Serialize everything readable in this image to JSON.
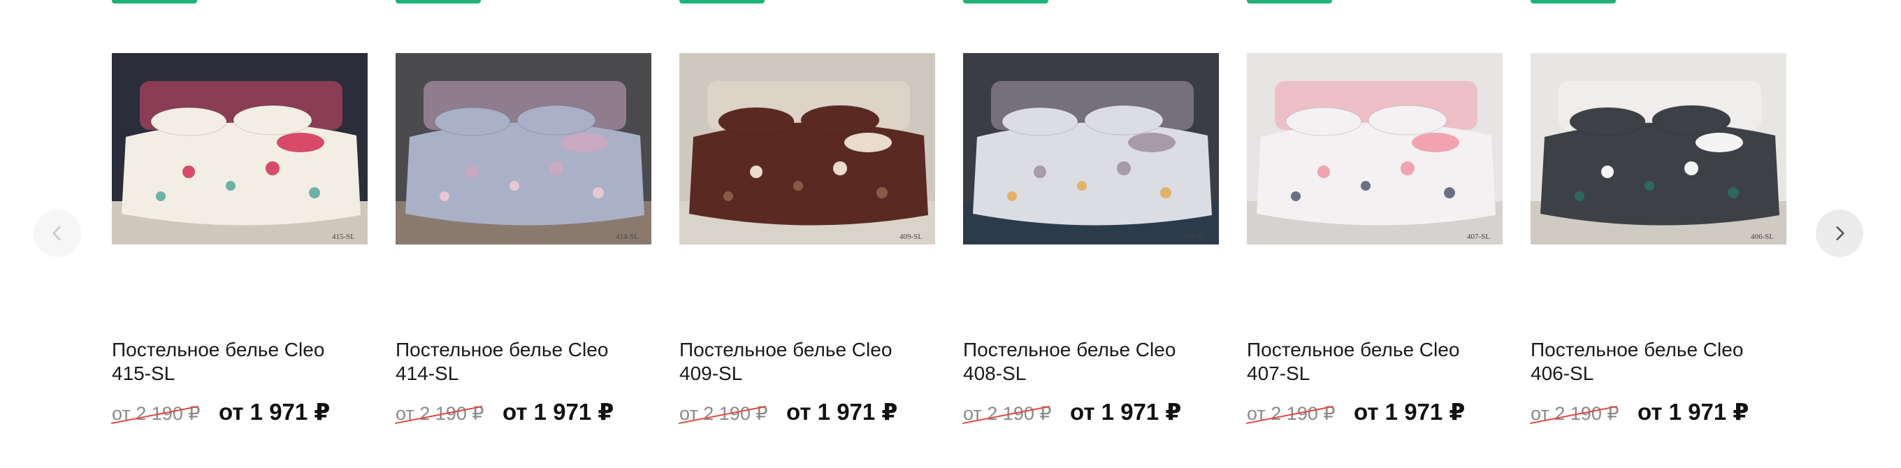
{
  "carousel": {
    "prev_icon": "chevron-left-icon",
    "next_icon": "chevron-right-icon",
    "products": [
      {
        "title": "Постельное белье Cleo 415-SL",
        "old_price": "от 2 190 ₽",
        "price": "от 1 971 ₽",
        "image_caption": "415-SL",
        "palette": {
          "wall": "#2b2d3a",
          "bed": "#f2eee4",
          "accent": "#d94a6a",
          "accent2": "#6fb2a8",
          "floor": "#cfc7bb"
        }
      },
      {
        "title": "Постельное белье Cleo 414-SL",
        "old_price": "от 2 190 ₽",
        "price": "от 1 971 ₽",
        "image_caption": "414-SL",
        "palette": {
          "wall": "#4b4b4e",
          "bed": "#a9b0c8",
          "accent": "#c9a8c2",
          "accent2": "#e8c8d0",
          "floor": "#8a7a6e"
        }
      },
      {
        "title": "Постельное белье Cleo 409-SL",
        "old_price": "от 2 190 ₽",
        "price": "от 1 971 ₽",
        "image_caption": "409-SL",
        "palette": {
          "wall": "#cfc8bf",
          "bed": "#5a2a22",
          "accent": "#e9dccc",
          "accent2": "#8b5a46",
          "floor": "#d9d3ca"
        }
      },
      {
        "title": "Постельное белье Cleo 408-SL",
        "old_price": "от 2 190 ₽",
        "price": "от 1 971 ₽",
        "image_caption": "408-SL",
        "palette": {
          "wall": "#3a3d44",
          "bed": "#dcdde3",
          "accent": "#a89aa6",
          "accent2": "#e3b26a",
          "floor": "#2b3b4a"
        }
      },
      {
        "title": "Постельное белье Cleo 407-SL",
        "old_price": "от 2 190 ₽",
        "price": "от 1 971 ₽",
        "image_caption": "407-SL",
        "palette": {
          "wall": "#e7e5e3",
          "bed": "#f3f1f2",
          "accent": "#f2a3b0",
          "accent2": "#6b6f86",
          "floor": "#d6d2cf"
        }
      },
      {
        "title": "Постельное белье Cleo 406-SL",
        "old_price": "от 2 190 ₽",
        "price": "от 1 971 ₽",
        "image_caption": "406-SL",
        "palette": {
          "wall": "#e8e6e2",
          "bed": "#3e4048",
          "accent": "#f4f4f4",
          "accent2": "#2d6a5a",
          "floor": "#cfcac2"
        }
      }
    ]
  }
}
